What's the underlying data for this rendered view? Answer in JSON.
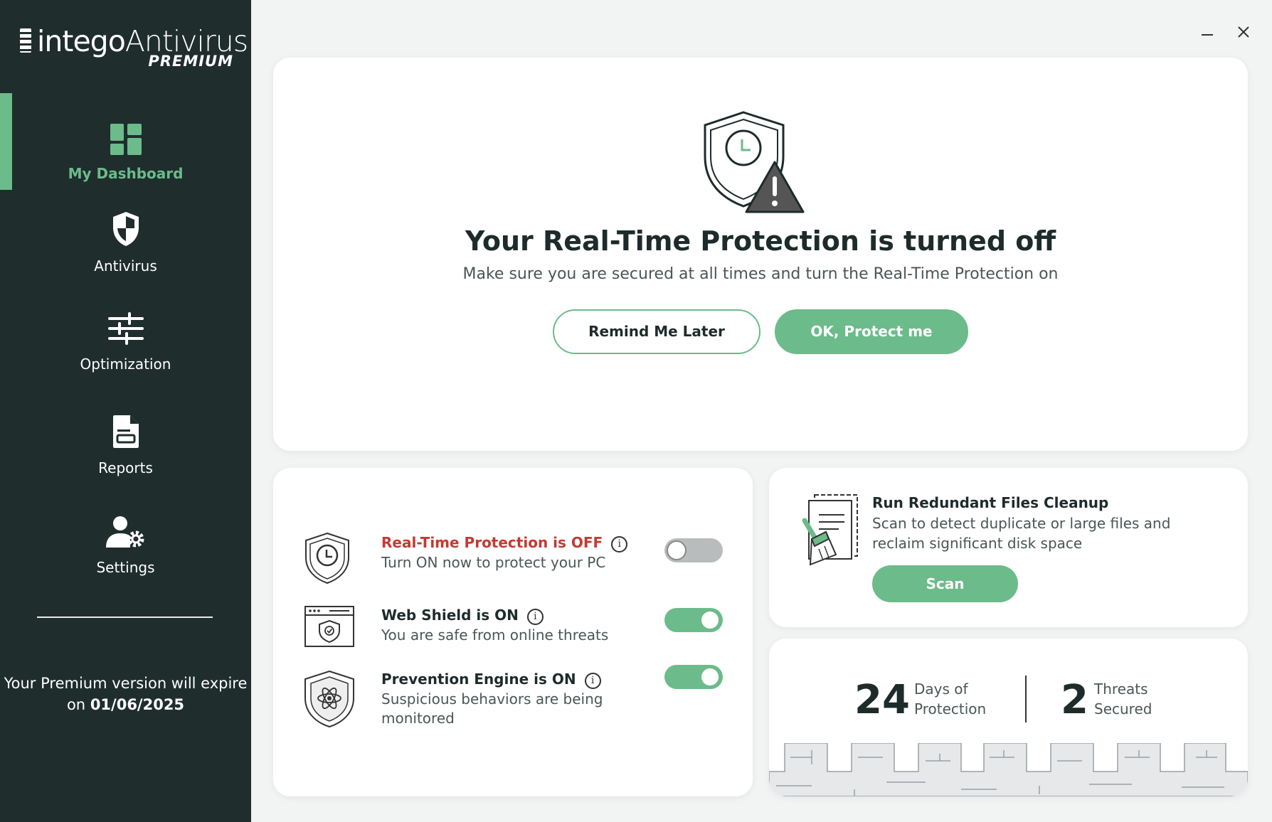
{
  "app": {
    "brand": "intego",
    "product": "Antivirus",
    "edition": "PREMIUM"
  },
  "sidebar": {
    "items": [
      {
        "label": "My Dashboard",
        "icon": "dashboard-icon",
        "active": true
      },
      {
        "label": "Antivirus",
        "icon": "shield-icon",
        "active": false
      },
      {
        "label": "Optimization",
        "icon": "sliders-icon",
        "active": false
      },
      {
        "label": "Reports",
        "icon": "report-icon",
        "active": false
      },
      {
        "label": "Settings",
        "icon": "user-gear-icon",
        "active": false
      }
    ],
    "expire_text": "Your Premium version will expire on",
    "expire_date": "01/06/2025"
  },
  "main_alert": {
    "title": "Your Real-Time Protection is turned off",
    "subtitle": "Make sure you are secured at all times and turn the Real-Time Protection on",
    "remind_label": "Remind Me Later",
    "protect_label": "OK, Protect me"
  },
  "protection": {
    "items": [
      {
        "title": "Real-Time Protection is OFF",
        "desc": "Turn ON now to protect your PC",
        "enabled": false,
        "status": "off"
      },
      {
        "title": "Web Shield is ON",
        "desc": "You are safe from online threats",
        "enabled": true,
        "status": "on"
      },
      {
        "title": "Prevention Engine is ON",
        "desc": "Suspicious behaviors are being monitored",
        "enabled": true,
        "status": "on"
      }
    ]
  },
  "cleanup": {
    "title": "Run Redundant Files Cleanup",
    "desc": "Scan to detect duplicate or large files and reclaim significant disk space",
    "scan_label": "Scan"
  },
  "stats": {
    "days": "24",
    "days_label_1": "Days of",
    "days_label_2": "Protection",
    "threats": "2",
    "threats_label_1": "Threats",
    "threats_label_2": "Secured"
  },
  "colors": {
    "sidebar_bg": "#1f2d2d",
    "accent": "#6cbb8a",
    "off_red": "#c23a33"
  }
}
